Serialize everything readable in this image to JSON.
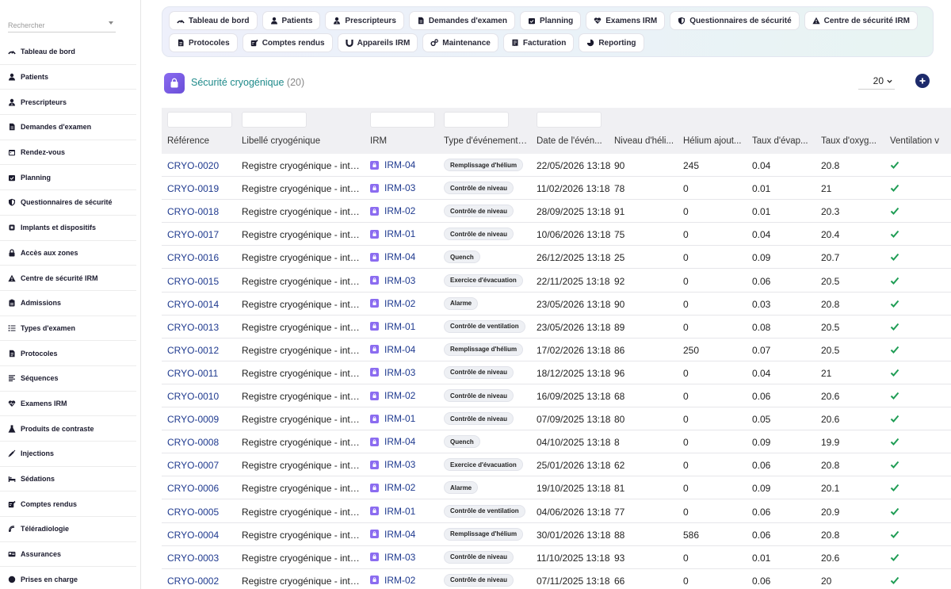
{
  "search": {
    "placeholder": "Rechercher"
  },
  "sidebar": {
    "items": [
      {
        "label": "Tableau de bord",
        "icon": "dashboard-icon"
      },
      {
        "label": "Patients",
        "icon": "user-icon"
      },
      {
        "label": "Prescripteurs",
        "icon": "user-doctor-icon"
      },
      {
        "label": "Demandes d'examen",
        "icon": "file-icon"
      },
      {
        "label": "Rendez-vous",
        "icon": "calendar-icon"
      },
      {
        "label": "Planning",
        "icon": "calendar-check-icon"
      },
      {
        "label": "Questionnaires de sécurité",
        "icon": "shield-icon"
      },
      {
        "label": "Implants et dispositifs",
        "icon": "chip-icon"
      },
      {
        "label": "Accès aux zones",
        "icon": "lock-icon"
      },
      {
        "label": "Centre de sécurité IRM",
        "icon": "warning-icon"
      },
      {
        "label": "Admissions",
        "icon": "clipboard-icon"
      },
      {
        "label": "Types d'examen",
        "icon": "list-icon"
      },
      {
        "label": "Protocoles",
        "icon": "document-icon"
      },
      {
        "label": "Séquences",
        "icon": "lines-icon"
      },
      {
        "label": "Examens IRM",
        "icon": "heartbeat-icon"
      },
      {
        "label": "Produits de contraste",
        "icon": "flask-icon"
      },
      {
        "label": "Injections",
        "icon": "syringe-icon"
      },
      {
        "label": "Sédations",
        "icon": "bed-icon"
      },
      {
        "label": "Comptes rendus",
        "icon": "edit-icon"
      },
      {
        "label": "Téléradiologie",
        "icon": "satellite-icon"
      },
      {
        "label": "Assurances",
        "icon": "card-icon"
      },
      {
        "label": "Prises en charge",
        "icon": "circle-icon"
      }
    ]
  },
  "topnav": {
    "row1": [
      {
        "label": "Tableau de bord",
        "icon": "dashboard-icon"
      },
      {
        "label": "Patients",
        "icon": "user-icon"
      },
      {
        "label": "Prescripteurs",
        "icon": "user-doctor-icon"
      },
      {
        "label": "Demandes d'examen",
        "icon": "file-icon"
      },
      {
        "label": "Planning",
        "icon": "calendar-check-icon"
      },
      {
        "label": "Examens IRM",
        "icon": "heartbeat-icon"
      },
      {
        "label": "Questionnaires de sécurité",
        "icon": "shield-icon"
      },
      {
        "label": "Centre de sécurité IRM",
        "icon": "warning-icon"
      }
    ],
    "row2": [
      {
        "label": "Protocoles",
        "icon": "document-icon"
      },
      {
        "label": "Comptes rendus",
        "icon": "edit-icon"
      },
      {
        "label": "Appareils IRM",
        "icon": "magnet-icon"
      },
      {
        "label": "Maintenance",
        "icon": "gears-icon"
      },
      {
        "label": "Facturation",
        "icon": "invoice-icon"
      },
      {
        "label": "Reporting",
        "icon": "chart-icon"
      }
    ]
  },
  "page": {
    "title": "Sécurité cryogénique",
    "count": "(20)",
    "per_page": "20",
    "icon": "lock-bag-icon"
  },
  "colors": {
    "accent": "#1e8a8a",
    "link": "#1f3a8f",
    "purple": "#8b6cf0",
    "check": "#1f9d55"
  },
  "table": {
    "columns": [
      "Référence",
      "Libellé cryogénique",
      "IRM",
      "Type d'événement ...",
      "Date de l'évén...",
      "Niveau d'héli...",
      "Hélium ajout...",
      "Taux d'évap...",
      "Taux d'oxyg...",
      "Ventilation v"
    ],
    "rows": [
      {
        "ref": "CRYO-0020",
        "label": "Registre cryogénique - inter...",
        "irm": "IRM-04",
        "type": "Remplissage d'hélium",
        "date": "22/05/2026 13:18",
        "level": "90",
        "added": "245",
        "evap": "0.04",
        "oxy": "20.8",
        "vent": true
      },
      {
        "ref": "CRYO-0019",
        "label": "Registre cryogénique - inter...",
        "irm": "IRM-03",
        "type": "Contrôle de niveau",
        "date": "11/02/2026 13:18",
        "level": "78",
        "added": "0",
        "evap": "0.01",
        "oxy": "21",
        "vent": true
      },
      {
        "ref": "CRYO-0018",
        "label": "Registre cryogénique - inter...",
        "irm": "IRM-02",
        "type": "Contrôle de niveau",
        "date": "28/09/2025 13:18",
        "level": "91",
        "added": "0",
        "evap": "0.01",
        "oxy": "20.3",
        "vent": true
      },
      {
        "ref": "CRYO-0017",
        "label": "Registre cryogénique - inter...",
        "irm": "IRM-01",
        "type": "Contrôle de niveau",
        "date": "10/06/2026 13:18",
        "level": "75",
        "added": "0",
        "evap": "0.04",
        "oxy": "20.4",
        "vent": true
      },
      {
        "ref": "CRYO-0016",
        "label": "Registre cryogénique - inter...",
        "irm": "IRM-04",
        "type": "Quench",
        "date": "26/12/2025 13:18",
        "level": "25",
        "added": "0",
        "evap": "0.09",
        "oxy": "20.7",
        "vent": true
      },
      {
        "ref": "CRYO-0015",
        "label": "Registre cryogénique - inter...",
        "irm": "IRM-03",
        "type": "Exercice d'évacuation",
        "date": "22/11/2025 13:18",
        "level": "92",
        "added": "0",
        "evap": "0.06",
        "oxy": "20.5",
        "vent": true
      },
      {
        "ref": "CRYO-0014",
        "label": "Registre cryogénique - inter...",
        "irm": "IRM-02",
        "type": "Alarme",
        "date": "23/05/2026 13:18",
        "level": "90",
        "added": "0",
        "evap": "0.03",
        "oxy": "20.8",
        "vent": true
      },
      {
        "ref": "CRYO-0013",
        "label": "Registre cryogénique - inter...",
        "irm": "IRM-01",
        "type": "Contrôle de ventilation",
        "date": "23/05/2026 13:18",
        "level": "89",
        "added": "0",
        "evap": "0.08",
        "oxy": "20.5",
        "vent": true
      },
      {
        "ref": "CRYO-0012",
        "label": "Registre cryogénique - inter...",
        "irm": "IRM-04",
        "type": "Remplissage d'hélium",
        "date": "17/02/2026 13:18",
        "level": "86",
        "added": "250",
        "evap": "0.07",
        "oxy": "20.5",
        "vent": true
      },
      {
        "ref": "CRYO-0011",
        "label": "Registre cryogénique - inter...",
        "irm": "IRM-03",
        "type": "Contrôle de niveau",
        "date": "18/12/2025 13:18",
        "level": "96",
        "added": "0",
        "evap": "0.04",
        "oxy": "21",
        "vent": true
      },
      {
        "ref": "CRYO-0010",
        "label": "Registre cryogénique - inter...",
        "irm": "IRM-02",
        "type": "Contrôle de niveau",
        "date": "16/09/2025 13:18",
        "level": "68",
        "added": "0",
        "evap": "0.06",
        "oxy": "20.6",
        "vent": true
      },
      {
        "ref": "CRYO-0009",
        "label": "Registre cryogénique - inter...",
        "irm": "IRM-01",
        "type": "Contrôle de niveau",
        "date": "07/09/2025 13:18",
        "level": "80",
        "added": "0",
        "evap": "0.05",
        "oxy": "20.6",
        "vent": true
      },
      {
        "ref": "CRYO-0008",
        "label": "Registre cryogénique - inter...",
        "irm": "IRM-04",
        "type": "Quench",
        "date": "04/10/2025 13:18",
        "level": "8",
        "added": "0",
        "evap": "0.09",
        "oxy": "19.9",
        "vent": true
      },
      {
        "ref": "CRYO-0007",
        "label": "Registre cryogénique - inter...",
        "irm": "IRM-03",
        "type": "Exercice d'évacuation",
        "date": "25/01/2026 13:18",
        "level": "62",
        "added": "0",
        "evap": "0.06",
        "oxy": "20.8",
        "vent": true
      },
      {
        "ref": "CRYO-0006",
        "label": "Registre cryogénique - inter...",
        "irm": "IRM-02",
        "type": "Alarme",
        "date": "19/10/2025 13:18",
        "level": "81",
        "added": "0",
        "evap": "0.09",
        "oxy": "20.1",
        "vent": true
      },
      {
        "ref": "CRYO-0005",
        "label": "Registre cryogénique - inter...",
        "irm": "IRM-01",
        "type": "Contrôle de ventilation",
        "date": "04/06/2026 13:18",
        "level": "77",
        "added": "0",
        "evap": "0.06",
        "oxy": "20.9",
        "vent": true
      },
      {
        "ref": "CRYO-0004",
        "label": "Registre cryogénique - inter...",
        "irm": "IRM-04",
        "type": "Remplissage d'hélium",
        "date": "30/01/2026 13:18",
        "level": "88",
        "added": "586",
        "evap": "0.06",
        "oxy": "20.8",
        "vent": true
      },
      {
        "ref": "CRYO-0003",
        "label": "Registre cryogénique - inter...",
        "irm": "IRM-03",
        "type": "Contrôle de niveau",
        "date": "11/10/2025 13:18",
        "level": "93",
        "added": "0",
        "evap": "0.01",
        "oxy": "20.6",
        "vent": true
      },
      {
        "ref": "CRYO-0002",
        "label": "Registre cryogénique - inter...",
        "irm": "IRM-02",
        "type": "Contrôle de niveau",
        "date": "07/11/2025 13:18",
        "level": "66",
        "added": "0",
        "evap": "0.06",
        "oxy": "20",
        "vent": true
      }
    ]
  }
}
